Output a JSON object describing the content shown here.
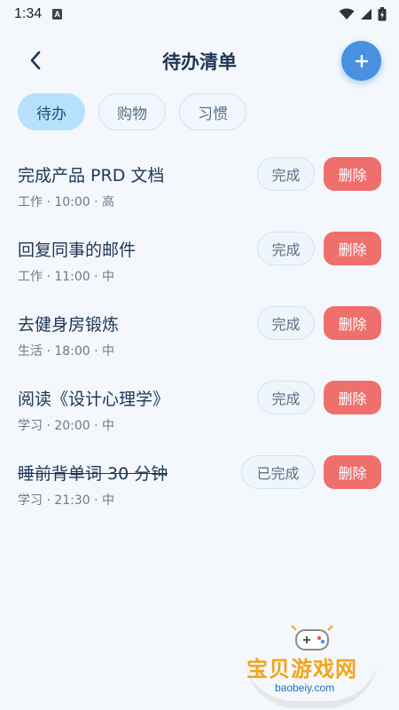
{
  "status_bar": {
    "time": "1:34",
    "sim_label": "A"
  },
  "header": {
    "title": "待办清单"
  },
  "tabs": [
    {
      "label": "待办",
      "active": true
    },
    {
      "label": "购物",
      "active": false
    },
    {
      "label": "习惯",
      "active": false
    }
  ],
  "todos": [
    {
      "title": "完成产品 PRD 文档",
      "meta": "工作 · 10:00 · 高",
      "status": "完成",
      "delete": "删除",
      "done": false
    },
    {
      "title": "回复同事的邮件",
      "meta": "工作 · 11:00 · 中",
      "status": "完成",
      "delete": "删除",
      "done": false
    },
    {
      "title": "去健身房锻炼",
      "meta": "生活 · 18:00 · 中",
      "status": "完成",
      "delete": "删除",
      "done": false
    },
    {
      "title": "阅读《设计心理学》",
      "meta": "学习 · 20:00 · 中",
      "status": "完成",
      "delete": "删除",
      "done": false
    },
    {
      "title": "睡前背单词 30 分钟",
      "meta": "学习 · 21:30 · 中",
      "status": "已完成",
      "delete": "删除",
      "done": true
    }
  ],
  "watermark": {
    "name": "宝贝游戏网",
    "url": "baobeiy.com"
  },
  "colors": {
    "accent": "#4a90e2",
    "delete": "#ef6f6c",
    "tab_active": "#b7e1fb",
    "background": "#f4f8fc"
  }
}
